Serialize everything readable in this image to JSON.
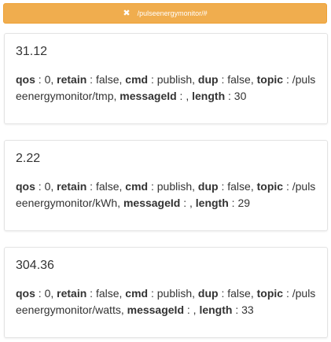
{
  "header": {
    "close_glyph": "✖",
    "topic": "/pulseenergymonitor/#",
    "color": "#f0ad4e"
  },
  "labels": {
    "qos": "qos",
    "retain": "retain",
    "cmd": "cmd",
    "dup": "dup",
    "topic": "topic",
    "messageId": "messageId",
    "length": "length"
  },
  "messages": [
    {
      "payload": "31.12",
      "qos": "0",
      "retain": "false",
      "cmd": "publish",
      "dup": "false",
      "topic": "/pulseenergymonitor/tmp",
      "messageId": "",
      "length": "30"
    },
    {
      "payload": "2.22",
      "qos": "0",
      "retain": "false",
      "cmd": "publish",
      "dup": "false",
      "topic": "/pulseenergymonitor/kWh",
      "messageId": "",
      "length": "29"
    },
    {
      "payload": "304.36",
      "qos": "0",
      "retain": "false",
      "cmd": "publish",
      "dup": "false",
      "topic": "/pulseenergymonitor/watts",
      "messageId": "",
      "length": "33"
    }
  ]
}
